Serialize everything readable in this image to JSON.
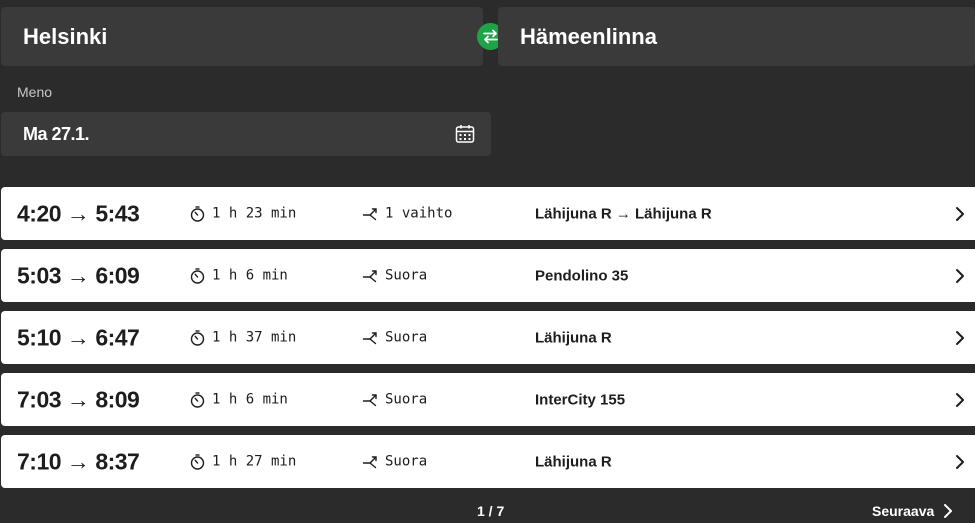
{
  "search": {
    "from": "Helsinki",
    "to": "Hämeenlinna",
    "date_label": "Meno",
    "date_value": "Ma 27.1."
  },
  "icons": {
    "swap": "swap-arrows-icon",
    "calendar": "calendar-icon",
    "duration": "stopwatch-icon",
    "changes": "route-branch-icon",
    "chevron": "chevron-right-icon"
  },
  "colors": {
    "background": "#2b2b2b",
    "field": "#3a3a3a",
    "accent": "#1fa347",
    "row": "#ffffff"
  },
  "connections": [
    {
      "times": "4:20 → 5:43",
      "duration": "1 h 23 min",
      "changes": "1 vaihto",
      "trains": "Lähijuna R → Lähijuna R"
    },
    {
      "times": "5:03 → 6:09",
      "duration": "1 h 6 min",
      "changes": "Suora",
      "trains": "Pendolino 35"
    },
    {
      "times": "5:10 → 6:47",
      "duration": "1 h 37 min",
      "changes": "Suora",
      "trains": "Lähijuna R"
    },
    {
      "times": "7:03 → 8:09",
      "duration": "1 h 6 min",
      "changes": "Suora",
      "trains": "InterCity 155"
    },
    {
      "times": "7:10 → 8:37",
      "duration": "1 h 27 min",
      "changes": "Suora",
      "trains": "Lähijuna R"
    }
  ],
  "pagination": {
    "page": "1 / 7",
    "next_label": "Seuraava"
  }
}
